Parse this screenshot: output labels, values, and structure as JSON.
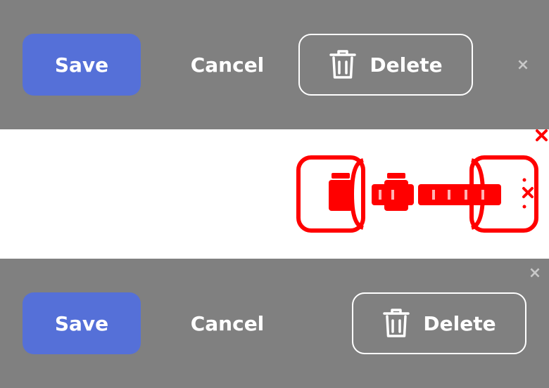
{
  "toolbar_top": {
    "save_label": "Save",
    "cancel_label": "Cancel",
    "delete_label": "Delete",
    "close_glyph": "×",
    "icons": {
      "delete": "trash-icon",
      "close": "close-icon"
    }
  },
  "toolbar_bottom": {
    "save_label": "Save",
    "cancel_label": "Cancel",
    "delete_label": "Delete",
    "close_glyph": "×",
    "icons": {
      "delete": "trash-icon",
      "close": "close-icon"
    }
  },
  "colors": {
    "panel_background": "#808080",
    "diff_background": "#ffffff",
    "save_fill": "#5570d8",
    "text": "#ffffff",
    "close": "#c8c8c8",
    "diff_highlight": "#ff0000"
  }
}
